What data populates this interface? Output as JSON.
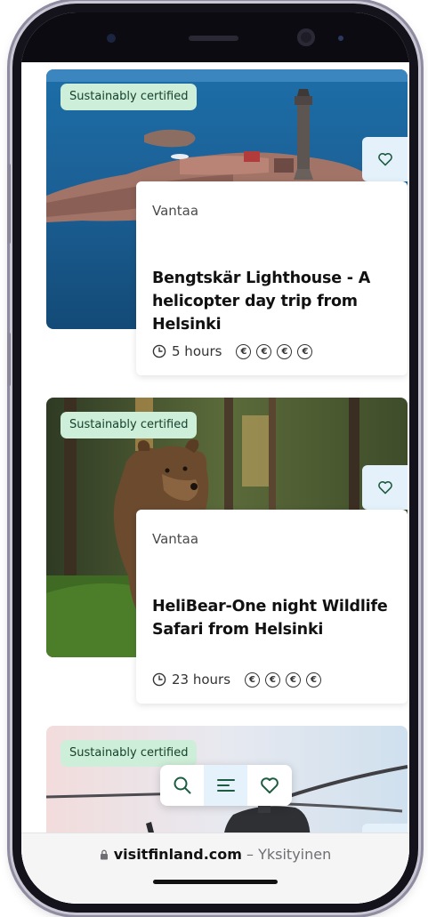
{
  "cards": [
    {
      "badge": "Sustainably certified",
      "location": "Vantaa",
      "title": "Bengtskär Lighthouse - A helicopter day trip from Helsinki",
      "duration": "5 hours",
      "price_symbol": "€",
      "price_level": 4,
      "image": "lighthouse-island-photo"
    },
    {
      "badge": "Sustainably certified",
      "location": "Vantaa",
      "title": "HeliBear-One night Wildlife Safari from Helsinki",
      "duration": "23 hours",
      "price_symbol": "€",
      "price_level": 4,
      "image": "brown-bear-forest-photo"
    },
    {
      "badge": "Sustainably certified",
      "image": "helicopter-photo"
    }
  ],
  "toolbar": {
    "items": [
      "search-icon",
      "menu-icon",
      "heart-icon"
    ],
    "active": "menu-icon"
  },
  "browser": {
    "domain": "visitfinland.com",
    "separator": "–",
    "mode": "Yksityinen"
  },
  "colors": {
    "badge_bg": "#cdeed8",
    "badge_text": "#16412c",
    "accent": "#1d5c40",
    "fav_bg": "#e4f1fb"
  }
}
